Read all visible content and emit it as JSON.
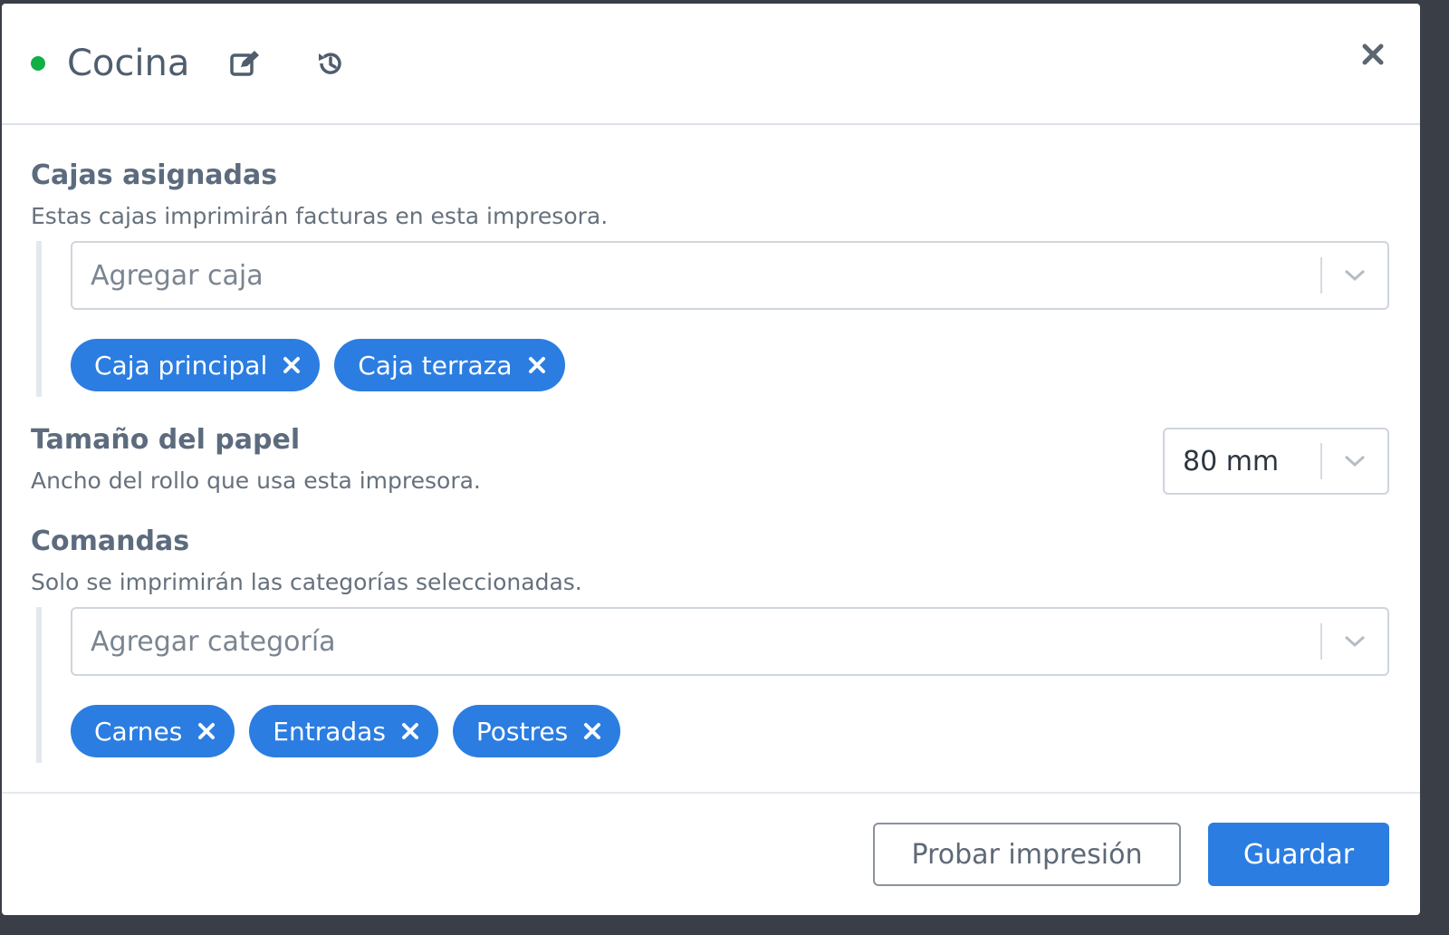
{
  "header": {
    "title": "Cocina",
    "status_color": "#10b045",
    "edit_icon": "edit-icon",
    "history_icon": "history-icon",
    "close_icon": "close-icon"
  },
  "cajas": {
    "title": "Cajas asignadas",
    "description": "Estas cajas imprimirán facturas en esta impresora.",
    "placeholder": "Agregar caja",
    "chips": [
      "Caja principal",
      "Caja terraza"
    ]
  },
  "papel": {
    "title": "Tamaño del papel",
    "description": "Ancho del rollo que usa esta impresora.",
    "value": "80 mm"
  },
  "comandas": {
    "title": "Comandas",
    "description": "Solo se imprimirán las categorías seleccionadas.",
    "placeholder": "Agregar categoría",
    "chips": [
      "Carnes",
      "Entradas",
      "Postres"
    ]
  },
  "footer": {
    "test_label": "Probar impresión",
    "save_label": "Guardar"
  },
  "colors": {
    "accent": "#2b7de1",
    "status_active": "#10b045"
  }
}
